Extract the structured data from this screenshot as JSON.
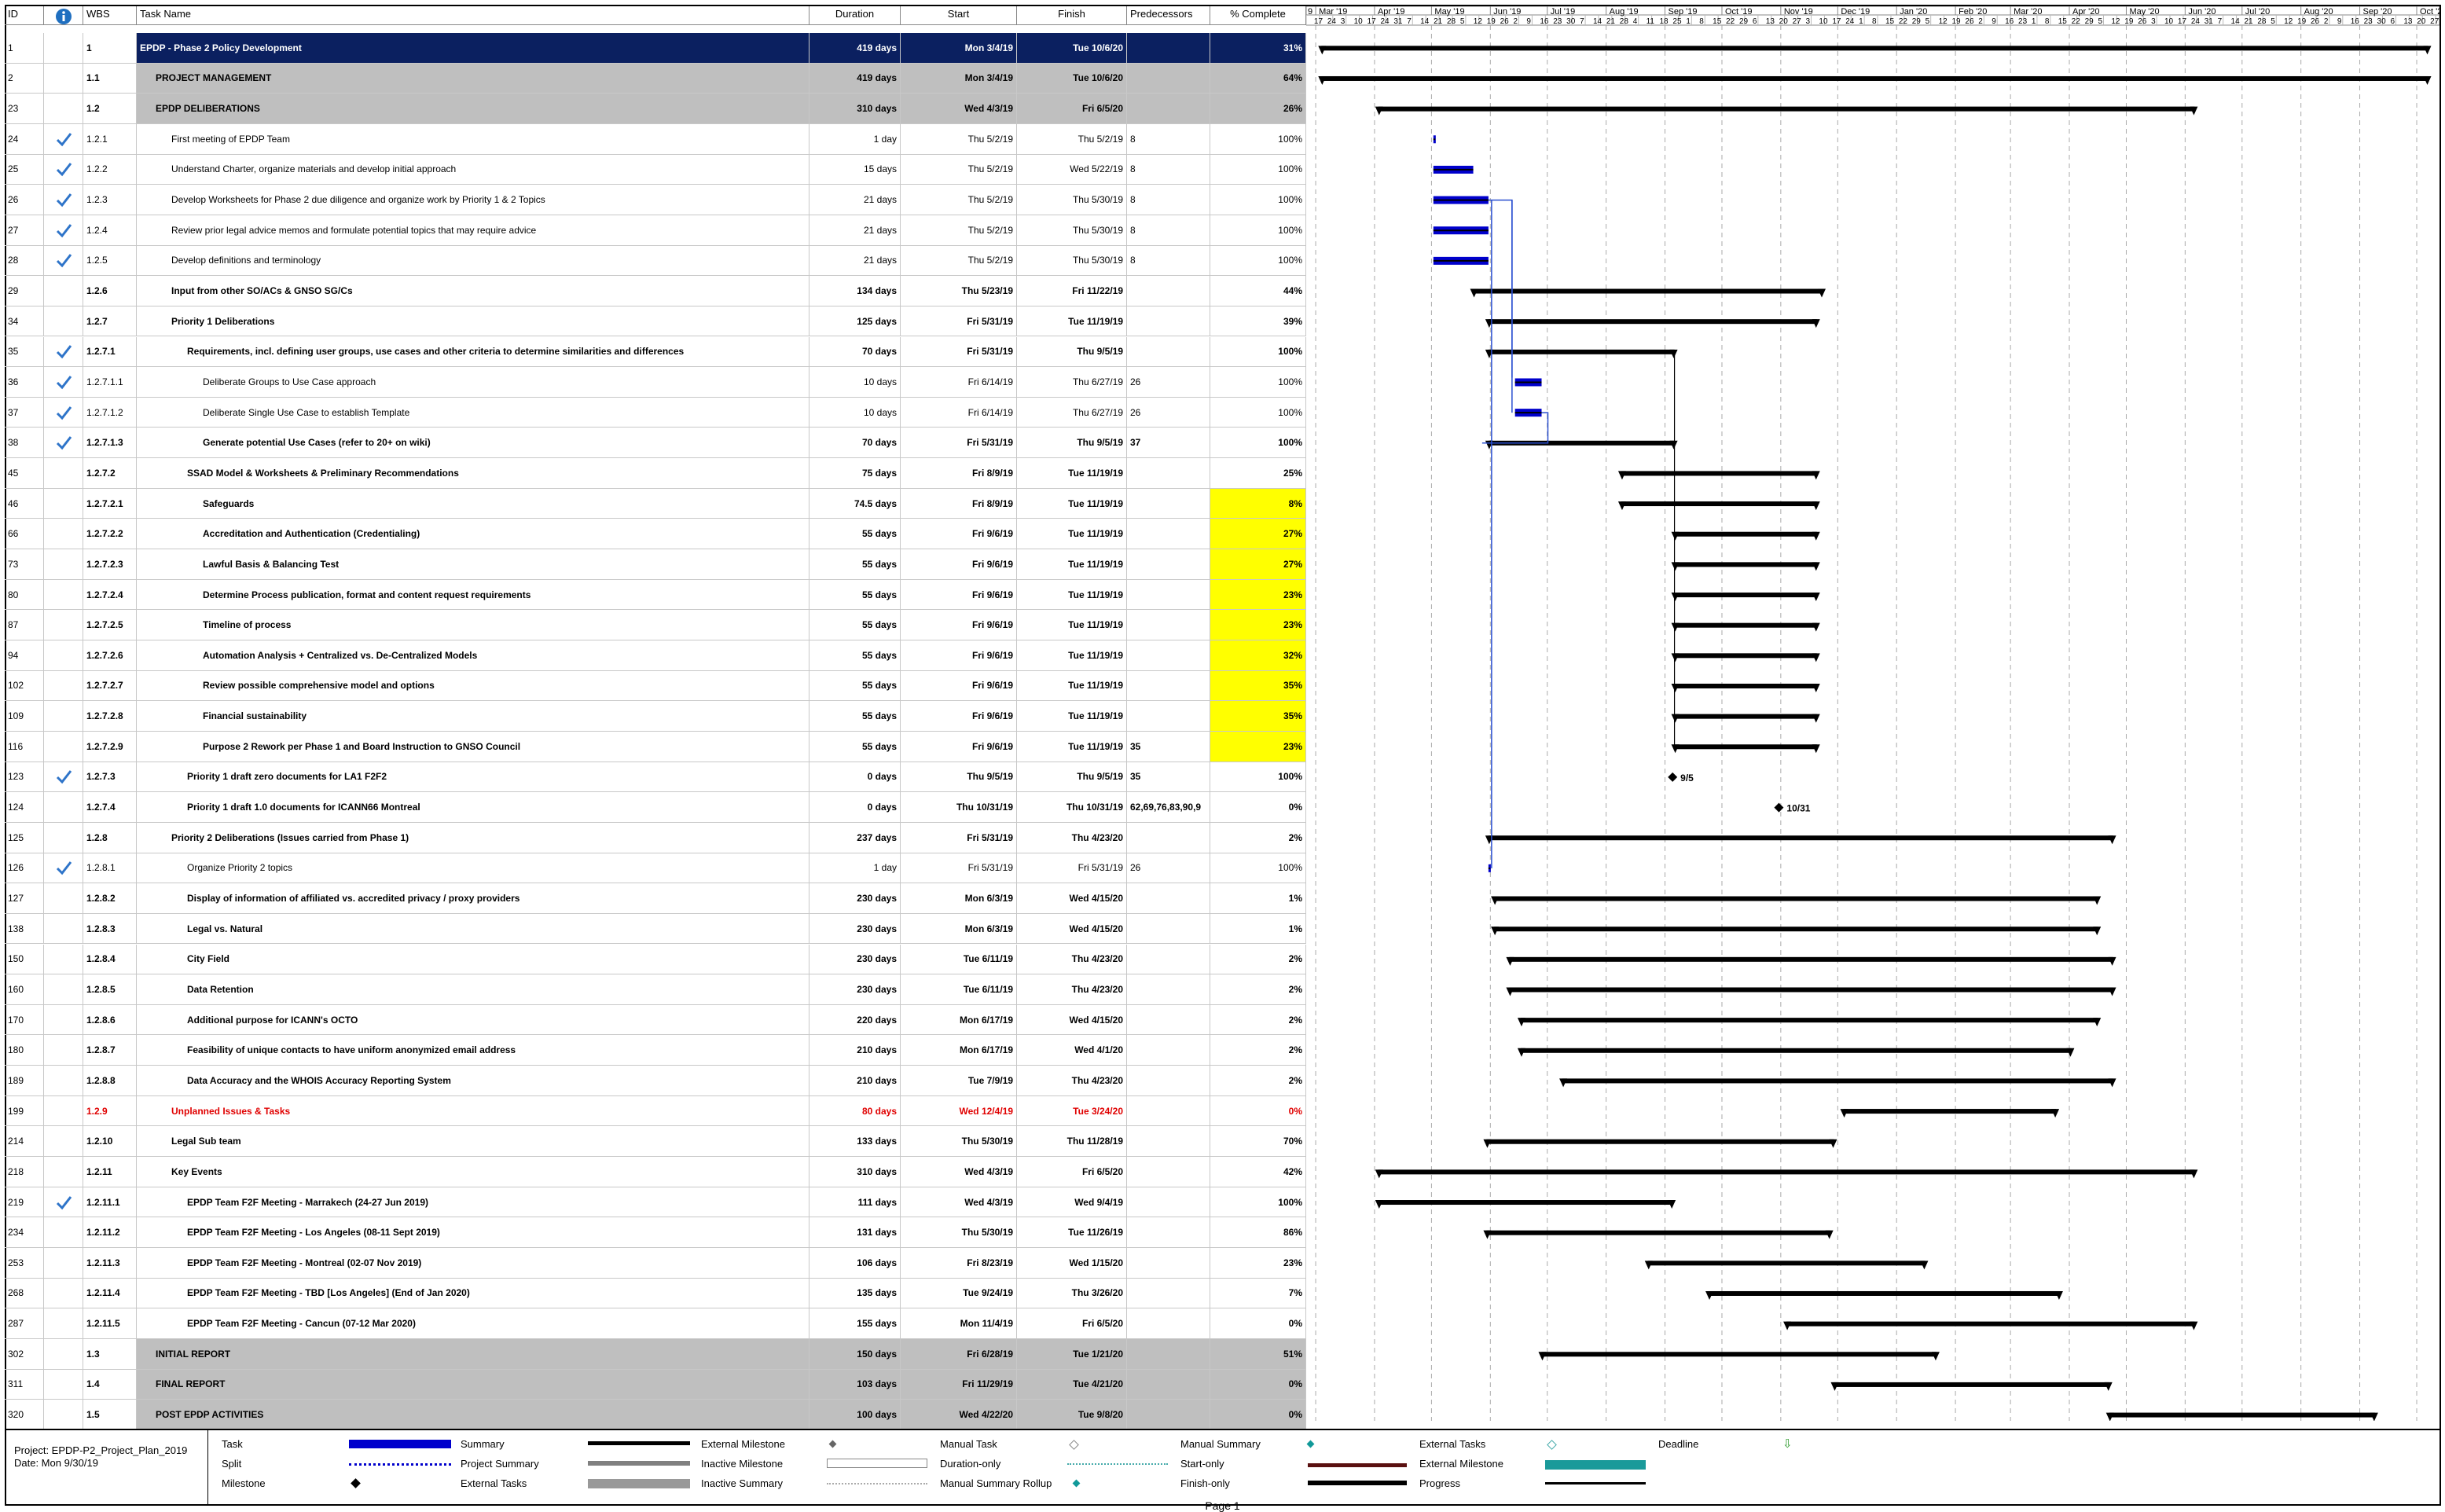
{
  "columns": [
    "ID",
    "WBS",
    "Task Name",
    "Duration",
    "Start",
    "Finish",
    "Predecessors",
    "% Complete"
  ],
  "info_icon": "info-icon",
  "timeline": {
    "months": [
      "Mar '19",
      "Apr '19",
      "May '19",
      "Jun '19",
      "Jul '19",
      "Aug '19",
      "Sep '19",
      "Oct '19",
      "Nov '19",
      "Dec '19",
      "Jan '20",
      "Feb '20",
      "Mar '20",
      "Apr '20",
      "May '20",
      "Jun '20",
      "Jul '20",
      "Aug '20",
      "Sep '20",
      "Oct '20"
    ],
    "first_label": "9",
    "days": [
      "17",
      "24",
      "3",
      "10",
      "17",
      "24",
      "31",
      "7",
      "14",
      "21",
      "28",
      "5",
      "12",
      "19",
      "26",
      "2",
      "9",
      "16",
      "23",
      "30",
      "7",
      "14",
      "21",
      "28",
      "4",
      "11",
      "18",
      "25",
      "1",
      "8",
      "15",
      "22",
      "29",
      "6",
      "13",
      "20",
      "27",
      "3",
      "10",
      "17",
      "24",
      "1",
      "8",
      "15",
      "22",
      "29",
      "5",
      "12",
      "19",
      "26",
      "2",
      "9",
      "16",
      "23",
      "1",
      "8",
      "15",
      "22",
      "29",
      "5",
      "12",
      "19",
      "26",
      "3",
      "10",
      "17",
      "24",
      "31",
      "7",
      "14",
      "21",
      "28",
      "5",
      "12",
      "19",
      "26",
      "2",
      "9",
      "16",
      "23",
      "30",
      "6",
      "13",
      "20",
      "27",
      "4",
      "11"
    ]
  },
  "tasks": [
    {
      "id": "1",
      "wbs": "1",
      "name": "EPDP - Phase 2 Policy Development",
      "duration": "419 days",
      "start": "Mon 3/4/19",
      "finish": "Tue 10/6/20",
      "pred": "",
      "pct": "31%",
      "style": "top",
      "check": false
    },
    {
      "id": "2",
      "wbs": "1.1",
      "name": "PROJECT MANAGEMENT",
      "duration": "419 days",
      "start": "Mon 3/4/19",
      "finish": "Tue 10/6/20",
      "pred": "",
      "pct": "64%",
      "style": "sum",
      "check": false
    },
    {
      "id": "23",
      "wbs": "1.2",
      "name": "EPDP DELIBERATIONS",
      "duration": "310 days",
      "start": "Wed 4/3/19",
      "finish": "Fri 6/5/20",
      "pred": "",
      "pct": "26%",
      "style": "sum",
      "check": false
    },
    {
      "id": "24",
      "wbs": "1.2.1",
      "name": "First meeting of EPDP Team",
      "duration": "1 day",
      "start": "Thu 5/2/19",
      "finish": "Thu 5/2/19",
      "pred": "8",
      "pct": "100%",
      "style": "",
      "check": true
    },
    {
      "id": "25",
      "wbs": "1.2.2",
      "name": "Understand Charter, organize materials and develop initial approach",
      "duration": "15 days",
      "start": "Thu 5/2/19",
      "finish": "Wed 5/22/19",
      "pred": "8",
      "pct": "100%",
      "style": "",
      "check": true
    },
    {
      "id": "26",
      "wbs": "1.2.3",
      "name": "Develop Worksheets for Phase 2 due diligence and organize work by Priority 1 & 2 Topics",
      "duration": "21 days",
      "start": "Thu 5/2/19",
      "finish": "Thu 5/30/19",
      "pred": "8",
      "pct": "100%",
      "style": "",
      "check": true
    },
    {
      "id": "27",
      "wbs": "1.2.4",
      "name": "Review prior legal advice memos and formulate potential topics that may require advice",
      "duration": "21 days",
      "start": "Thu 5/2/19",
      "finish": "Thu 5/30/19",
      "pred": "8",
      "pct": "100%",
      "style": "",
      "check": true
    },
    {
      "id": "28",
      "wbs": "1.2.5",
      "name": "Develop definitions and terminology",
      "duration": "21 days",
      "start": "Thu 5/2/19",
      "finish": "Thu 5/30/19",
      "pred": "8",
      "pct": "100%",
      "style": "",
      "check": true
    },
    {
      "id": "29",
      "wbs": "1.2.6",
      "name": "Input from other SO/ACs & GNSO SG/Cs",
      "duration": "134 days",
      "start": "Thu 5/23/19",
      "finish": "Fri 11/22/19",
      "pred": "",
      "pct": "44%",
      "style": "b",
      "check": false
    },
    {
      "id": "34",
      "wbs": "1.2.7",
      "name": "Priority 1 Deliberations",
      "duration": "125 days",
      "start": "Fri 5/31/19",
      "finish": "Tue 11/19/19",
      "pred": "",
      "pct": "39%",
      "style": "b",
      "check": false
    },
    {
      "id": "35",
      "wbs": "1.2.7.1",
      "name": "Requirements, incl. defining user groups, use cases and other criteria to determine similarities and differences",
      "duration": "70 days",
      "start": "Fri 5/31/19",
      "finish": "Thu 9/5/19",
      "pred": "",
      "pct": "100%",
      "style": "b",
      "check": true
    },
    {
      "id": "36",
      "wbs": "1.2.7.1.1",
      "name": "Deliberate Groups to Use Case approach",
      "duration": "10 days",
      "start": "Fri 6/14/19",
      "finish": "Thu 6/27/19",
      "pred": "26",
      "pct": "100%",
      "style": "",
      "check": true
    },
    {
      "id": "37",
      "wbs": "1.2.7.1.2",
      "name": "Deliberate Single Use Case to establish Template",
      "duration": "10 days",
      "start": "Fri 6/14/19",
      "finish": "Thu 6/27/19",
      "pred": "26",
      "pct": "100%",
      "style": "",
      "check": true
    },
    {
      "id": "38",
      "wbs": "1.2.7.1.3",
      "name": "Generate potential Use Cases (refer to 20+ on wiki)",
      "duration": "70 days",
      "start": "Fri 5/31/19",
      "finish": "Thu 9/5/19",
      "pred": "37",
      "pct": "100%",
      "style": "b",
      "check": true
    },
    {
      "id": "45",
      "wbs": "1.2.7.2",
      "name": "SSAD Model & Worksheets & Preliminary Recommendations",
      "duration": "75 days",
      "start": "Fri 8/9/19",
      "finish": "Tue 11/19/19",
      "pred": "",
      "pct": "25%",
      "style": "b",
      "check": false
    },
    {
      "id": "46",
      "wbs": "1.2.7.2.1",
      "name": "Safeguards",
      "duration": "74.5 days",
      "start": "Fri 8/9/19",
      "finish": "Tue 11/19/19",
      "pred": "",
      "pct": "8%",
      "style": "by",
      "check": false
    },
    {
      "id": "66",
      "wbs": "1.2.7.2.2",
      "name": "Accreditation and Authentication (Credentialing)",
      "duration": "55 days",
      "start": "Fri 9/6/19",
      "finish": "Tue 11/19/19",
      "pred": "",
      "pct": "27%",
      "style": "by",
      "check": false
    },
    {
      "id": "73",
      "wbs": "1.2.7.2.3",
      "name": "Lawful Basis & Balancing Test",
      "duration": "55 days",
      "start": "Fri 9/6/19",
      "finish": "Tue 11/19/19",
      "pred": "",
      "pct": "27%",
      "style": "by",
      "check": false
    },
    {
      "id": "80",
      "wbs": "1.2.7.2.4",
      "name": "Determine Process publication, format and content request requirements",
      "duration": "55 days",
      "start": "Fri 9/6/19",
      "finish": "Tue 11/19/19",
      "pred": "",
      "pct": "23%",
      "style": "by",
      "check": false
    },
    {
      "id": "87",
      "wbs": "1.2.7.2.5",
      "name": "Timeline of process",
      "duration": "55 days",
      "start": "Fri 9/6/19",
      "finish": "Tue 11/19/19",
      "pred": "",
      "pct": "23%",
      "style": "by",
      "check": false
    },
    {
      "id": "94",
      "wbs": "1.2.7.2.6",
      "name": "Automation Analysis + Centralized vs. De-Centralized Models",
      "duration": "55 days",
      "start": "Fri 9/6/19",
      "finish": "Tue 11/19/19",
      "pred": "",
      "pct": "32%",
      "style": "by",
      "check": false
    },
    {
      "id": "102",
      "wbs": "1.2.7.2.7",
      "name": "Review possible comprehensive model and options",
      "duration": "55 days",
      "start": "Fri 9/6/19",
      "finish": "Tue 11/19/19",
      "pred": "",
      "pct": "35%",
      "style": "by",
      "check": false
    },
    {
      "id": "109",
      "wbs": "1.2.7.2.8",
      "name": "Financial sustainability",
      "duration": "55 days",
      "start": "Fri 9/6/19",
      "finish": "Tue 11/19/19",
      "pred": "",
      "pct": "35%",
      "style": "by",
      "check": false
    },
    {
      "id": "116",
      "wbs": "1.2.7.2.9",
      "name": "Purpose 2 Rework per Phase 1 and Board Instruction to GNSO Council",
      "duration": "55 days",
      "start": "Fri 9/6/19",
      "finish": "Tue 11/19/19",
      "pred": "35",
      "pct": "23%",
      "style": "by",
      "check": false
    },
    {
      "id": "123",
      "wbs": "1.2.7.3",
      "name": "Priority 1 draft zero documents for LA1 F2F2",
      "duration": "0 days",
      "start": "Thu 9/5/19",
      "finish": "Thu 9/5/19",
      "pred": "35",
      "pct": "100%",
      "style": "b",
      "check": true
    },
    {
      "id": "124",
      "wbs": "1.2.7.4",
      "name": "Priority 1 draft 1.0 documents for ICANN66 Montreal",
      "duration": "0 days",
      "start": "Thu 10/31/19",
      "finish": "Thu 10/31/19",
      "pred": "62,69,76,83,90,9",
      "pct": "0%",
      "style": "b",
      "check": false
    },
    {
      "id": "125",
      "wbs": "1.2.8",
      "name": "Priority 2 Deliberations (Issues carried from Phase 1)",
      "duration": "237 days",
      "start": "Fri 5/31/19",
      "finish": "Thu 4/23/20",
      "pred": "",
      "pct": "2%",
      "style": "b",
      "check": false
    },
    {
      "id": "126",
      "wbs": "1.2.8.1",
      "name": "Organize Priority 2 topics",
      "duration": "1 day",
      "start": "Fri 5/31/19",
      "finish": "Fri 5/31/19",
      "pred": "26",
      "pct": "100%",
      "style": "",
      "check": true
    },
    {
      "id": "127",
      "wbs": "1.2.8.2",
      "name": "Display of information of affiliated vs. accredited privacy / proxy providers",
      "duration": "230 days",
      "start": "Mon 6/3/19",
      "finish": "Wed 4/15/20",
      "pred": "",
      "pct": "1%",
      "style": "b",
      "check": false
    },
    {
      "id": "138",
      "wbs": "1.2.8.3",
      "name": "Legal vs. Natural",
      "duration": "230 days",
      "start": "Mon 6/3/19",
      "finish": "Wed 4/15/20",
      "pred": "",
      "pct": "1%",
      "style": "b",
      "check": false
    },
    {
      "id": "150",
      "wbs": "1.2.8.4",
      "name": "City Field",
      "duration": "230 days",
      "start": "Tue 6/11/19",
      "finish": "Thu 4/23/20",
      "pred": "",
      "pct": "2%",
      "style": "b",
      "check": false
    },
    {
      "id": "160",
      "wbs": "1.2.8.5",
      "name": "Data Retention",
      "duration": "230 days",
      "start": "Tue 6/11/19",
      "finish": "Thu 4/23/20",
      "pred": "",
      "pct": "2%",
      "style": "b",
      "check": false
    },
    {
      "id": "170",
      "wbs": "1.2.8.6",
      "name": "Additional purpose for ICANN's OCTO",
      "duration": "220 days",
      "start": "Mon 6/17/19",
      "finish": "Wed 4/15/20",
      "pred": "",
      "pct": "2%",
      "style": "b",
      "check": false
    },
    {
      "id": "180",
      "wbs": "1.2.8.7",
      "name": "Feasibility of unique contacts to have uniform anonymized email address",
      "duration": "210 days",
      "start": "Mon 6/17/19",
      "finish": "Wed 4/1/20",
      "pred": "",
      "pct": "2%",
      "style": "b",
      "check": false
    },
    {
      "id": "189",
      "wbs": "1.2.8.8",
      "name": "Data Accuracy and the WHOIS Accuracy Reporting System",
      "duration": "210 days",
      "start": "Tue 7/9/19",
      "finish": "Thu 4/23/20",
      "pred": "",
      "pct": "2%",
      "style": "b",
      "check": false
    },
    {
      "id": "199",
      "wbs": "1.2.9",
      "name": "Unplanned Issues & Tasks",
      "duration": "80 days",
      "start": "Wed 12/4/19",
      "finish": "Tue 3/24/20",
      "pred": "",
      "pct": "0%",
      "style": "red",
      "check": false
    },
    {
      "id": "214",
      "wbs": "1.2.10",
      "name": "Legal Sub team",
      "duration": "133 days",
      "start": "Thu 5/30/19",
      "finish": "Thu 11/28/19",
      "pred": "",
      "pct": "70%",
      "style": "b",
      "check": false
    },
    {
      "id": "218",
      "wbs": "1.2.11",
      "name": "Key Events",
      "duration": "310 days",
      "start": "Wed 4/3/19",
      "finish": "Fri 6/5/20",
      "pred": "",
      "pct": "42%",
      "style": "b",
      "check": false
    },
    {
      "id": "219",
      "wbs": "1.2.11.1",
      "name": "EPDP Team F2F Meeting - Marrakech (24-27 Jun 2019)",
      "duration": "111 days",
      "start": "Wed 4/3/19",
      "finish": "Wed 9/4/19",
      "pred": "",
      "pct": "100%",
      "style": "b",
      "check": true
    },
    {
      "id": "234",
      "wbs": "1.2.11.2",
      "name": "EPDP Team F2F Meeting - Los Angeles (08-11 Sept 2019)",
      "duration": "131 days",
      "start": "Thu 5/30/19",
      "finish": "Tue 11/26/19",
      "pred": "",
      "pct": "86%",
      "style": "b",
      "check": false
    },
    {
      "id": "253",
      "wbs": "1.2.11.3",
      "name": "EPDP Team F2F Meeting - Montreal (02-07 Nov 2019)",
      "duration": "106 days",
      "start": "Fri 8/23/19",
      "finish": "Wed 1/15/20",
      "pred": "",
      "pct": "23%",
      "style": "b",
      "check": false
    },
    {
      "id": "268",
      "wbs": "1.2.11.4",
      "name": "EPDP Team F2F Meeting - TBD [Los Angeles] (End of Jan 2020)",
      "duration": "135 days",
      "start": "Tue 9/24/19",
      "finish": "Thu 3/26/20",
      "pred": "",
      "pct": "7%",
      "style": "b",
      "check": false
    },
    {
      "id": "287",
      "wbs": "1.2.11.5",
      "name": "EPDP Team F2F Meeting - Cancun (07-12 Mar 2020)",
      "duration": "155 days",
      "start": "Mon 11/4/19",
      "finish": "Fri 6/5/20",
      "pred": "",
      "pct": "0%",
      "style": "b",
      "check": false
    },
    {
      "id": "302",
      "wbs": "1.3",
      "name": "INITIAL REPORT",
      "duration": "150 days",
      "start": "Fri 6/28/19",
      "finish": "Tue 1/21/20",
      "pred": "",
      "pct": "51%",
      "style": "sum",
      "check": false
    },
    {
      "id": "311",
      "wbs": "1.4",
      "name": "FINAL REPORT",
      "duration": "103 days",
      "start": "Fri 11/29/19",
      "finish": "Tue 4/21/20",
      "pred": "",
      "pct": "0%",
      "style": "sum",
      "check": false
    },
    {
      "id": "320",
      "wbs": "1.5",
      "name": "POST EPDP ACTIVITIES",
      "duration": "100 days",
      "start": "Wed 4/22/20",
      "finish": "Tue 9/8/20",
      "pred": "",
      "pct": "0%",
      "style": "sum",
      "check": false
    }
  ],
  "milestone_labels": {
    "m123": "9/5",
    "m124": "10/31"
  },
  "legend": {
    "project": "Project: EPDP-P2_Project_Plan_2019",
    "date": "Date: Mon 9/30/19",
    "items": [
      "Task",
      "Split",
      "Milestone",
      "Summary",
      "Project Summary",
      "External Tasks",
      "External Milestone",
      "Inactive Milestone",
      "Inactive Summary",
      "Manual Task",
      "Duration-only",
      "Manual Summary Rollup",
      "Manual Summary",
      "Start-only",
      "Finish-only",
      "External Tasks",
      "External Milestone",
      "Progress",
      "Deadline"
    ]
  },
  "footer": "Page 1",
  "colors": {
    "task": "#0000cc",
    "summary": "#000000",
    "highlight": "#ffff00",
    "header": "#0b2060",
    "grey": "#bfbfbf"
  }
}
